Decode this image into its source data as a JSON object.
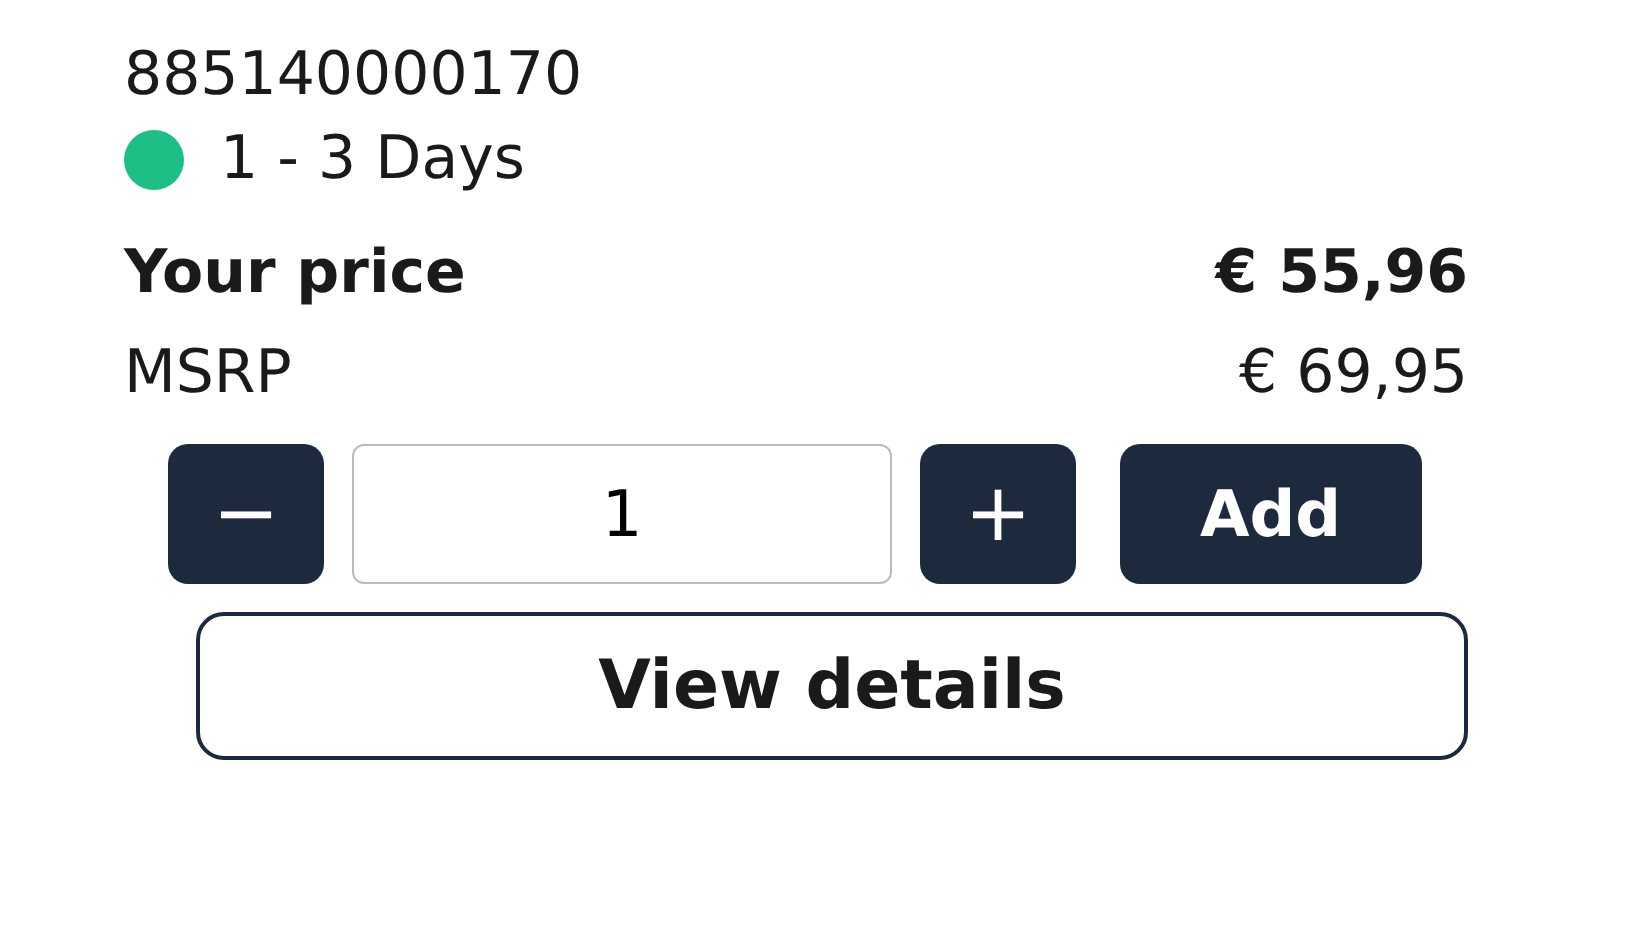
{
  "product": {
    "sku": "885140000170",
    "availability": {
      "label": "1 - 3 Days",
      "color": "#1dbf85"
    }
  },
  "prices": [
    {
      "label": "Your price",
      "amount": "€ 55,96",
      "kind": "current"
    },
    {
      "label": "MSRP",
      "amount": "€ 69,95",
      "kind": "list"
    }
  ],
  "quantity": {
    "decrease": "−",
    "value": "1",
    "increase": "+"
  },
  "buttons": {
    "add": "Add",
    "details": "View details"
  }
}
